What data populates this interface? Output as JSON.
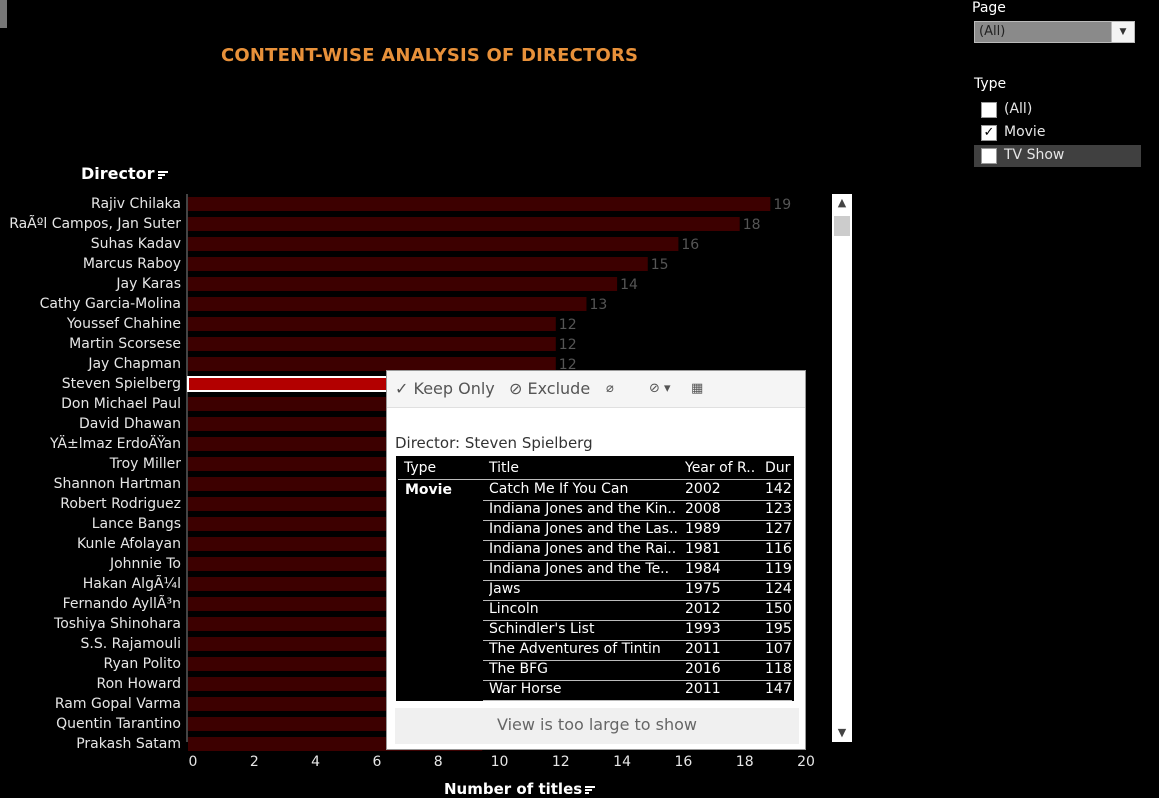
{
  "title": "CONTENT-WISE ANALYSIS OF DIRECTORS",
  "filters": {
    "page_label": "Page",
    "page_value": "(All)",
    "type_label": "Type",
    "type_options": [
      {
        "label": "(All)",
        "checked": false
      },
      {
        "label": "Movie",
        "checked": true
      },
      {
        "label": "TV Show",
        "checked": false
      }
    ]
  },
  "colors": {
    "bar": "#3d0000",
    "bar_selected": "#b30000",
    "value_label": "#555555",
    "title": "#e8913a"
  },
  "chart_data": {
    "type": "bar",
    "orientation": "horizontal",
    "ylabel": "Director",
    "xlabel": "Number of titles",
    "xlim": [
      0,
      20
    ],
    "xticks": [
      "0",
      "2",
      "4",
      "6",
      "8",
      "10",
      "12",
      "14",
      "16",
      "18",
      "20"
    ],
    "categories": [
      "Rajiv Chilaka",
      "RaÃºl Campos, Jan Suter",
      "Suhas Kadav",
      "Marcus Raboy",
      "Jay Karas",
      "Cathy Garcia-Molina",
      "Youssef Chahine",
      "Martin Scorsese",
      "Jay Chapman",
      "Steven Spielberg",
      "Don Michael Paul",
      "David Dhawan",
      "YÄ±lmaz ErdoÄŸan",
      "Troy Miller",
      "Shannon Hartman",
      "Robert Rodriguez",
      "Lance Bangs",
      "Kunle Afolayan",
      "Johnnie To",
      "Hakan AlgÃ¼l",
      "Fernando AyllÃ³n",
      "Toshiya Shinohara",
      "S.S. Rajamouli",
      "Ryan Polito",
      "Ron Howard",
      "Ram Gopal Varma",
      "Quentin Tarantino",
      "Prakash Satam"
    ],
    "values": [
      19,
      18,
      16,
      15,
      14,
      13,
      12,
      12,
      12,
      null,
      null,
      null,
      null,
      null,
      null,
      null,
      null,
      null,
      null,
      null,
      null,
      null,
      null,
      null,
      null,
      null,
      null,
      null
    ],
    "value_labels": [
      "19",
      "18",
      "16",
      "15",
      "14",
      "13",
      "12",
      "12",
      "12",
      "",
      "",
      "",
      "",
      "",
      "",
      "",
      "",
      "",
      "",
      "",
      "",
      "",
      "",
      "",
      "",
      "",
      "",
      ""
    ],
    "selected": "Steven Spielberg"
  },
  "tooltip": {
    "actions": {
      "keep_only": "Keep Only",
      "exclude": "Exclude"
    },
    "heading": "Director: Steven Spielberg",
    "columns": [
      "Type",
      "Title",
      "Year of R..",
      "Dur"
    ],
    "type_value": "Movie",
    "rows": [
      {
        "title": "Catch Me If You Can",
        "year": "2002",
        "dur": "142"
      },
      {
        "title": "Indiana Jones and the Kin..",
        "year": "2008",
        "dur": "123"
      },
      {
        "title": "Indiana Jones and the Las..",
        "year": "1989",
        "dur": "127"
      },
      {
        "title": "Indiana Jones and the Rai..",
        "year": "1981",
        "dur": "116"
      },
      {
        "title": "Indiana Jones and the Te..",
        "year": "1984",
        "dur": "119"
      },
      {
        "title": "Jaws",
        "year": "1975",
        "dur": "124"
      },
      {
        "title": "Lincoln",
        "year": "2012",
        "dur": "150"
      },
      {
        "title": "Schindler's List",
        "year": "1993",
        "dur": "195"
      },
      {
        "title": "The Adventures of Tintin",
        "year": "2011",
        "dur": "107"
      },
      {
        "title": "The BFG",
        "year": "2016",
        "dur": "118"
      },
      {
        "title": "War Horse",
        "year": "2011",
        "dur": "147"
      }
    ],
    "footer": "View is too large to show"
  }
}
